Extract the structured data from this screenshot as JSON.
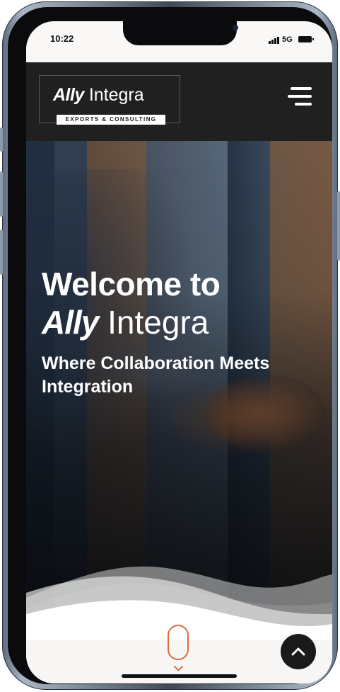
{
  "status_bar": {
    "time": "10:22",
    "network": "5G",
    "signal_icon": "signal-bars-icon",
    "battery_icon": "battery-icon"
  },
  "header": {
    "logo": {
      "word_ally": "Ally",
      "word_integra": "Integra",
      "tagline": "EXPORTS & CONSULTING"
    },
    "menu_icon": "hamburger-menu-icon"
  },
  "hero": {
    "title_line": "Welcome to",
    "brand_ally": "Ally",
    "brand_integra": "Integra",
    "subtitle": "Where Collaboration Meets Integration"
  },
  "controls": {
    "scroll_icon": "scroll-down-icon",
    "back_to_top_icon": "chevron-up-icon"
  },
  "colors": {
    "header_bg": "#202020",
    "accent_orange": "#e26a3c",
    "button_dark": "#1a1a1a",
    "text_white": "#ffffff"
  }
}
